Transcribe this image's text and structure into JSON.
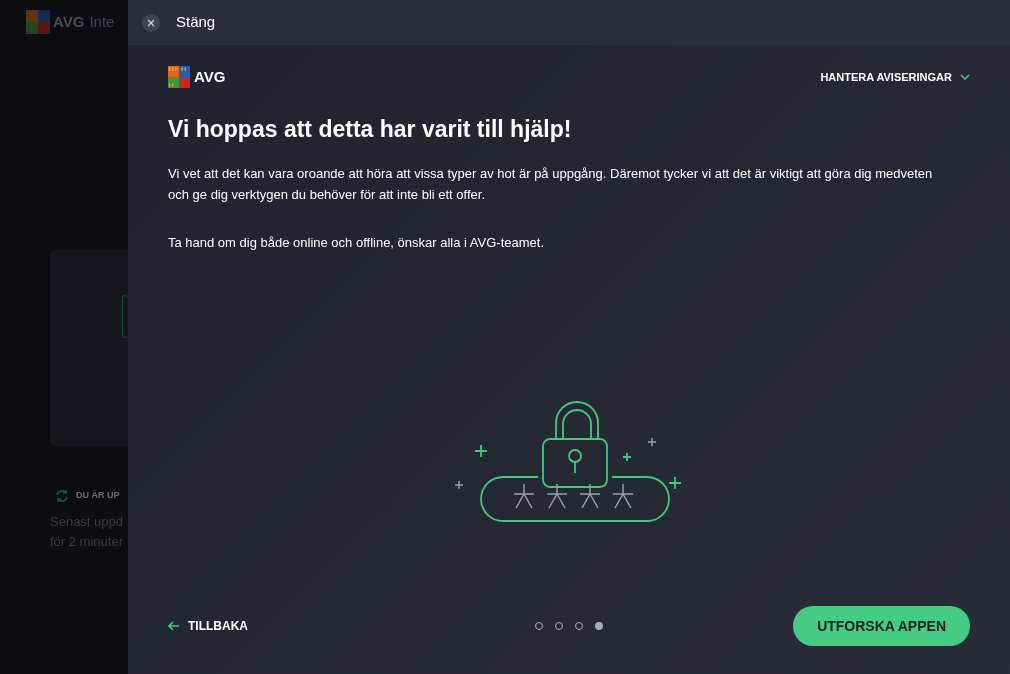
{
  "background_app": {
    "brand": "AVG",
    "title": "Inte",
    "status": "DU ÄR UP",
    "status_detail": [
      "Senast uppd",
      "för 2 minuter"
    ]
  },
  "panel": {
    "close_label": "Stäng",
    "brand": "AVG",
    "manage_notifications": "HANTERA AVISERINGAR",
    "heading": "Vi hoppas att detta har varit till hjälp!",
    "paragraphs": [
      "Vi vet att det kan vara oroande att höra att vissa typer av hot är på uppgång. Däremot tycker vi att det är viktigt att göra dig medveten och ge dig verktygen du behöver för att inte bli ett offer.",
      "Ta hand om dig både online och offline, önskar alla i AVG-teamet."
    ],
    "back_label": "TILLBAKA",
    "pages": [
      {
        "selected": false
      },
      {
        "selected": false
      },
      {
        "selected": false
      },
      {
        "selected": true
      }
    ],
    "primary_button": "UTFORSKA APPEN"
  }
}
